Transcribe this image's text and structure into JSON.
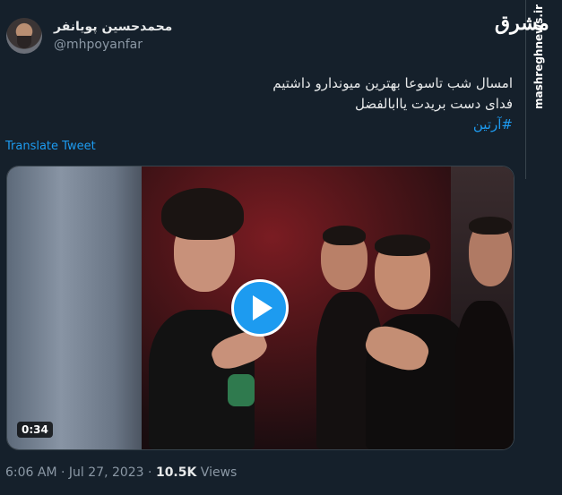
{
  "author": {
    "display_name": "محمدحسین پویانفر",
    "handle": "@mhpoyanfar",
    "avatar": "avatar-icon"
  },
  "tweet": {
    "lines": [
      "امسال شب تاسوعا بهترین میوندارو داشتیم",
      "فدای دست بریدت یاابالفضل"
    ],
    "hashtag": "#آرتین",
    "translate_label": "Translate Tweet"
  },
  "video": {
    "duration": "0:34",
    "play_icon": "play-icon"
  },
  "meta": {
    "time": "6:06 AM",
    "separator": "·",
    "date": "Jul 27, 2023",
    "views_count": "10.5K",
    "views_label": "Views"
  },
  "watermark": {
    "logo": "مشرق",
    "site": "mashreghnews.ir"
  },
  "colors": {
    "background": "#15202b",
    "accent": "#1d9bf0",
    "text": "#e7e9ea",
    "muted": "#8b98a5"
  }
}
